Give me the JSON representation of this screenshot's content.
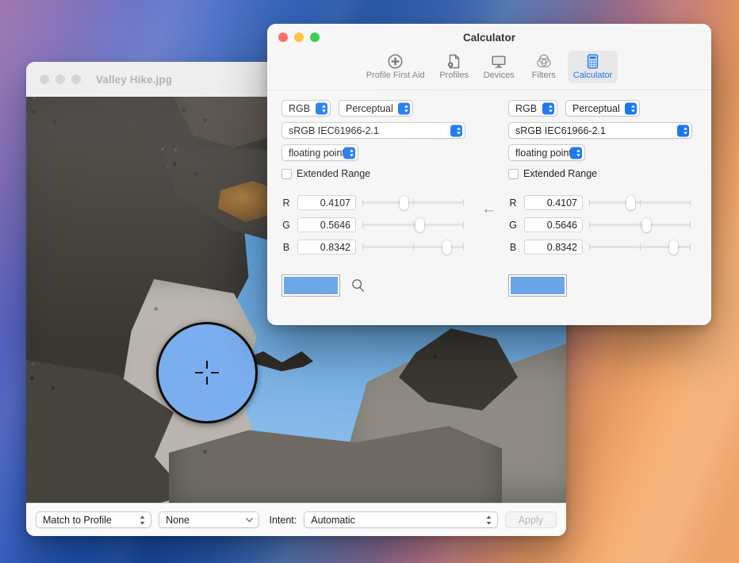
{
  "desktop": {
    "wallpaper_name": "macos-sequoia-gradient"
  },
  "photo_window": {
    "title": "Valley Hike.jpg",
    "active": false,
    "traffic_lights": [
      "close",
      "minimize",
      "zoom"
    ],
    "toolbar": {
      "match_mode": "Match to Profile",
      "profile": "None",
      "intent_label": "Intent:",
      "intent_value": "Automatic",
      "apply_label": "Apply",
      "apply_enabled": false
    },
    "loupe": {
      "sampled_color": "#7AAEEE",
      "crosshair_icon": "crosshair-icon"
    }
  },
  "colorsync_window": {
    "title": "Calculator",
    "active": true,
    "traffic_lights": [
      "close",
      "minimize",
      "zoom"
    ],
    "toolbar": {
      "items": [
        {
          "label": "Profile First Aid",
          "icon": "first-aid-icon",
          "selected": false
        },
        {
          "label": "Profiles",
          "icon": "profile-document-icon",
          "selected": false
        },
        {
          "label": "Devices",
          "icon": "display-icon",
          "selected": false
        },
        {
          "label": "Filters",
          "icon": "venn-filters-icon",
          "selected": false
        },
        {
          "label": "Calculator",
          "icon": "calculator-icon",
          "selected": true
        }
      ],
      "accent_color": "#1A76F2"
    },
    "left_panel": {
      "color_space": "RGB",
      "intent": "Perceptual",
      "profile": "sRGB IEC61966-2.1",
      "data_type": "floating point",
      "extended_range_label": "Extended Range",
      "extended_range_checked": false,
      "channels": [
        {
          "label": "R",
          "value": "0.4107",
          "fraction": 0.4107
        },
        {
          "label": "G",
          "value": "0.5646",
          "fraction": 0.5646
        },
        {
          "label": "B",
          "value": "0.8342",
          "fraction": 0.8342
        }
      ],
      "swatch_color": "#6BA4E8"
    },
    "right_panel": {
      "color_space": "RGB",
      "intent": "Perceptual",
      "profile": "sRGB IEC61966-2.1",
      "data_type": "floating point",
      "extended_range_label": "Extended Range",
      "extended_range_checked": false,
      "channels": [
        {
          "label": "R",
          "value": "0.4107",
          "fraction": 0.4107
        },
        {
          "label": "G",
          "value": "0.5646",
          "fraction": 0.5646
        },
        {
          "label": "B",
          "value": "0.8342",
          "fraction": 0.8342
        }
      ],
      "swatch_color": "#6BA4E8"
    },
    "direction_arrow": "←",
    "magnifier_icon": "magnifier-icon"
  }
}
